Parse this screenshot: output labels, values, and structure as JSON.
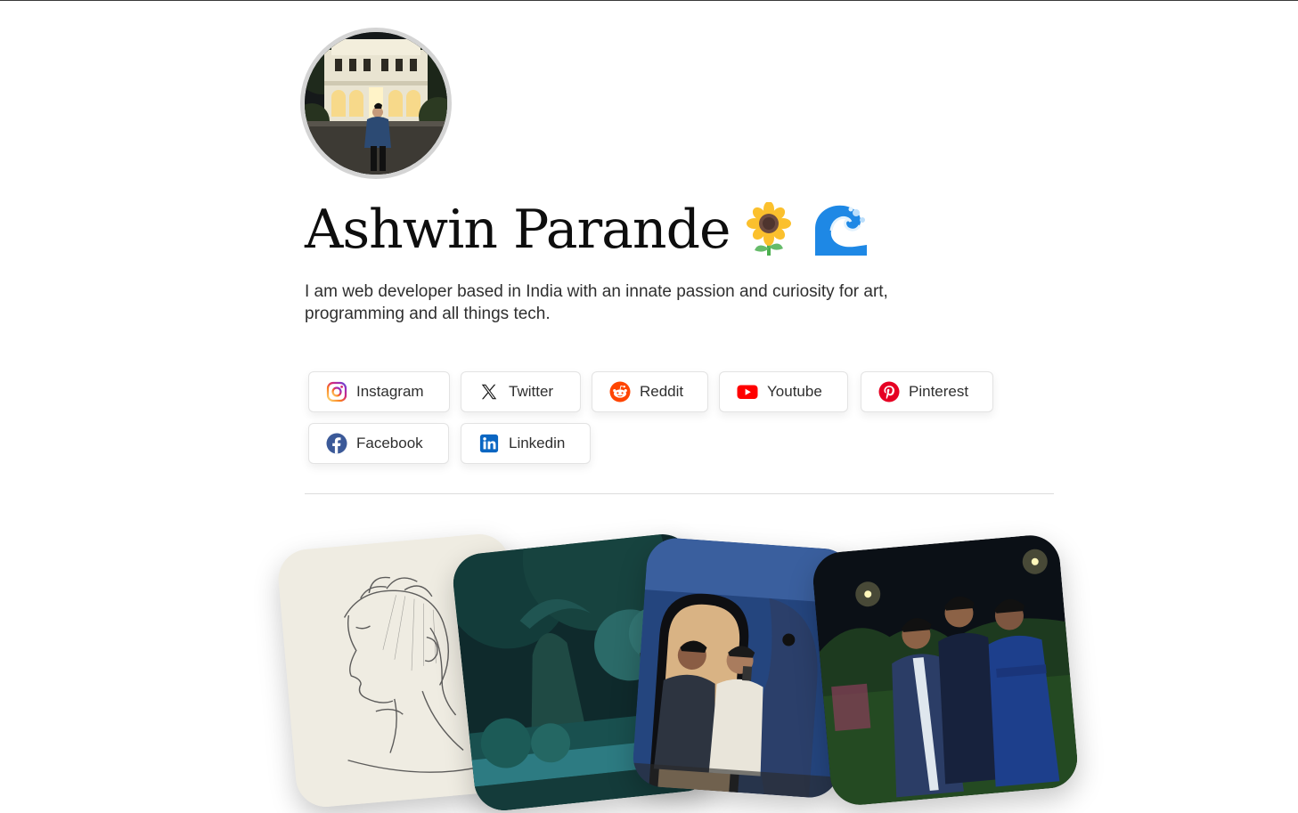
{
  "profile": {
    "name": "Ashwin Parande",
    "emoji_1": "sunflower",
    "emoji_2": "wave",
    "bio": "I am web developer based in India with an innate passion and curiosity for art, programming and all things tech."
  },
  "socials": [
    {
      "label": "Instagram",
      "icon": "instagram-icon"
    },
    {
      "label": "Twitter",
      "icon": "x-icon"
    },
    {
      "label": "Reddit",
      "icon": "reddit-icon"
    },
    {
      "label": "Youtube",
      "icon": "youtube-icon"
    },
    {
      "label": "Pinterest",
      "icon": "pinterest-icon"
    },
    {
      "label": "Facebook",
      "icon": "facebook-icon"
    },
    {
      "label": "Linkedin",
      "icon": "linkedin-icon"
    }
  ],
  "gallery": [
    {
      "name": "sketch-portrait"
    },
    {
      "name": "forest-painting"
    },
    {
      "name": "mirror-selfie-photo"
    },
    {
      "name": "night-group-photo"
    }
  ],
  "colors": {
    "instagram": "#e1306c",
    "reddit": "#ff4500",
    "youtube": "#ff0000",
    "pinterest": "#e60023",
    "facebook": "#1877f2",
    "linkedin": "#0a66c2"
  }
}
